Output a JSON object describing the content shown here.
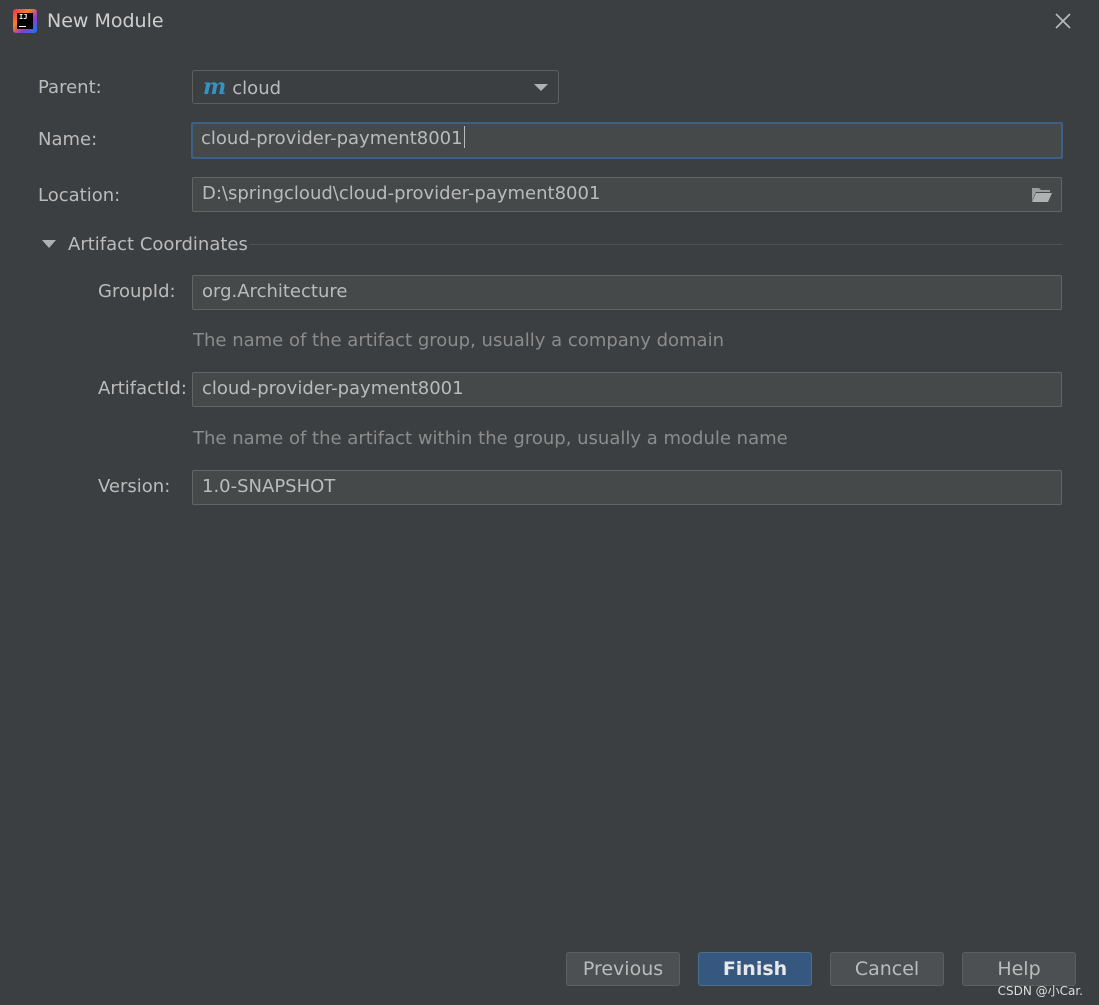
{
  "window": {
    "title": "New Module"
  },
  "form": {
    "parent": {
      "label": "Parent:",
      "value": "cloud",
      "icon": "maven-m-icon"
    },
    "name": {
      "label": "Name:",
      "value": "cloud-provider-payment8001"
    },
    "location": {
      "label": "Location:",
      "value": "D:\\springcloud\\cloud-provider-payment8001",
      "icon": "folder-icon"
    }
  },
  "artifact": {
    "section_label": "Artifact Coordinates",
    "group_id": {
      "label": "GroupId:",
      "value": "org.Architecture",
      "hint": "The name of the artifact group, usually a company domain"
    },
    "artifact_id": {
      "label": "ArtifactId:",
      "value": "cloud-provider-payment8001",
      "hint": "The name of the artifact within the group, usually a module name"
    },
    "version": {
      "label": "Version:",
      "value": "1.0-SNAPSHOT"
    }
  },
  "buttons": {
    "previous": "Previous",
    "finish": "Finish",
    "cancel": "Cancel",
    "help": "Help"
  },
  "watermark": "CSDN @小Car.",
  "colors": {
    "background": "#3c3f41",
    "field": "#45494a",
    "focus_border": "#3d6185",
    "primary_button": "#365880",
    "maven_icon": "#3592c4"
  }
}
